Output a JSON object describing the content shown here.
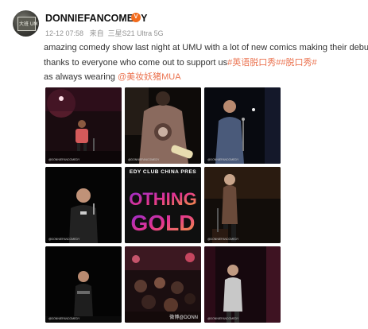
{
  "author": {
    "avatar_text": "大班 UM",
    "name": "DONNIEFANCOMEDY",
    "badge_icon": "vip-icon"
  },
  "meta": {
    "timestamp": "12-12 07:58",
    "source_prefix": "来自",
    "device": "三星S21 Ultra 5G"
  },
  "post": {
    "line1": "amazing comedy show last night at UMU with a lot of new comics making their debuts!",
    "line2_text": "thanks to everyone who come out to support us",
    "line2_tag1": "#英语脱口秀#",
    "line2_tag2": "#脱口秀#",
    "line3_text": "as always wearing ",
    "line3_mention": "@美妆妖猪MUA",
    "accent_color": "#eb7350"
  },
  "photos": {
    "watermark_small": "@DONNIEFANCOMEDY",
    "banner_text": "EDY CLUB CHINA PRES",
    "poster_text_top": "OTHING",
    "poster_text_bottom": "GOLD",
    "overlay_watermark": "微博@DONN"
  }
}
